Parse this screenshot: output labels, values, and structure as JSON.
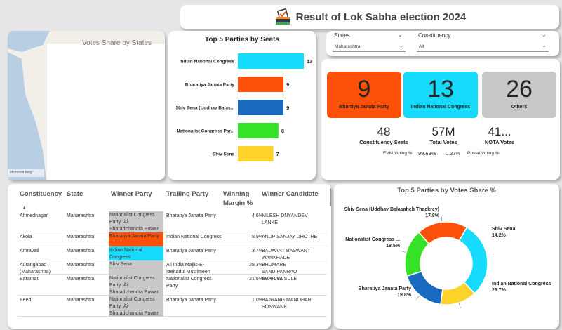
{
  "header": {
    "title": "Result of Lok Sabha election 2024",
    "logo_icon": "ballot-box-icon"
  },
  "map": {
    "title": "Votes Share by States",
    "credit": "Microsoft Bing"
  },
  "filters": {
    "states_label": "States",
    "states_value": "Maharashtra",
    "constituency_label": "Constituency",
    "constituency_value": "All"
  },
  "kpis": [
    {
      "value": "9",
      "label": "Bhartiya Janata Party",
      "color": "#fd5008"
    },
    {
      "value": "13",
      "label": "Indian National Congress",
      "color": "#17dbfc"
    },
    {
      "value": "26",
      "label": "Others",
      "color": "#c8c8c8"
    }
  ],
  "stats": [
    {
      "value": "48",
      "label": "Constituency Seats"
    },
    {
      "value": "57M",
      "label": "Total Votes"
    },
    {
      "value": "41...",
      "label": "NOTA Votes"
    }
  ],
  "voting": {
    "evm_label": "EVM Voting %",
    "evm_value": "99.63%",
    "postal_value": "0.37%",
    "postal_label": "Postal Voting %"
  },
  "chart_data": [
    {
      "type": "bar",
      "title": "Top 5 Parties by Seats",
      "orientation": "horizontal",
      "categories": [
        "Indian National Congress",
        "Bharatiya Janata Party",
        "Shiv Sena (Uddhav Balas...",
        "Nationalist Congress Par...",
        "Shiv Sena"
      ],
      "values": [
        13,
        9,
        9,
        8,
        7
      ],
      "colors": [
        "#17dbfc",
        "#fd5008",
        "#1a6bbf",
        "#36e228",
        "#fdd32a"
      ],
      "data_labels": true,
      "xlim": [
        0,
        13
      ]
    },
    {
      "type": "pie",
      "subtype": "donut",
      "title": "Top 5 Parties by Votes Share %",
      "categories": [
        "Indian National Congress",
        "Shiv Sena",
        "Shiv Sena (Uddhav Balasaheb Thackrey)",
        "Nationalist Congress ...",
        "Bharatiya Janata Party"
      ],
      "values": [
        29.7,
        14.2,
        17.8,
        18.5,
        19.8
      ],
      "labels": [
        "29.7%",
        "14.2%",
        "17.8%",
        "18.5%",
        "19.8%"
      ],
      "colors": [
        "#17dbfc",
        "#fdd32a",
        "#1a6bbf",
        "#36e228",
        "#fd5008"
      ]
    }
  ],
  "table": {
    "columns": [
      "Constituency",
      "State",
      "Winner Party",
      "Trailing Party",
      "Winning Margin %",
      "Winner Candidate"
    ],
    "rows": [
      {
        "constituency": "Ahmednagar",
        "state": "Maharashtra",
        "winner_party": "Nationalist Congress Party ,Äì Sharadchandra Pawar",
        "winner_color": "#c8c8c8",
        "trailing": "Bharatiya Janata Party",
        "margin": "4.6%",
        "candidate": "NILESH DNYANDEV LANKE"
      },
      {
        "constituency": "Akola",
        "state": "Maharashtra",
        "winner_party": "Bharatiya Janata Party",
        "winner_color": "#fd5008",
        "trailing": "Indian National Congress",
        "margin": "8.9%",
        "candidate": "ANUP SANJAY DHOTRE"
      },
      {
        "constituency": "Amravati",
        "state": "Maharashtra",
        "winner_party": "Indian National Congress",
        "winner_color": "#17dbfc",
        "trailing": "Bharatiya Janata Party",
        "margin": "3.7%",
        "candidate": "BALWANT BASWANT WANKHADE"
      },
      {
        "constituency": "Aurangabad (Maharashtra)",
        "state": "Maharashtra",
        "winner_party": "Shiv Sena",
        "winner_color": "#c8c8c8",
        "trailing": "All India Majlis-E-Ittehadul Muslimeen",
        "margin": "28.3%",
        "candidate": "BHUMARE SANDIPANRAO ASARAM"
      },
      {
        "constituency": "Baramati",
        "state": "Maharashtra",
        "winner_party": "Nationalist Congress Party ,Äì Sharadchandra Pawar",
        "winner_color": "#c8c8c8",
        "trailing": "Nationalist Congress Party",
        "margin": "21.6%",
        "candidate": "SUPRIYA SULE"
      },
      {
        "constituency": "Beed",
        "state": "Maharashtra",
        "winner_party": "Nationalist Congress Party ,Äì Sharadchandra Pawar",
        "winner_color": "#c8c8c8",
        "trailing": "Bharatiya Janata Party",
        "margin": "1.0%",
        "candidate": "BAJRANG MANOHAR SONWANE"
      }
    ]
  }
}
